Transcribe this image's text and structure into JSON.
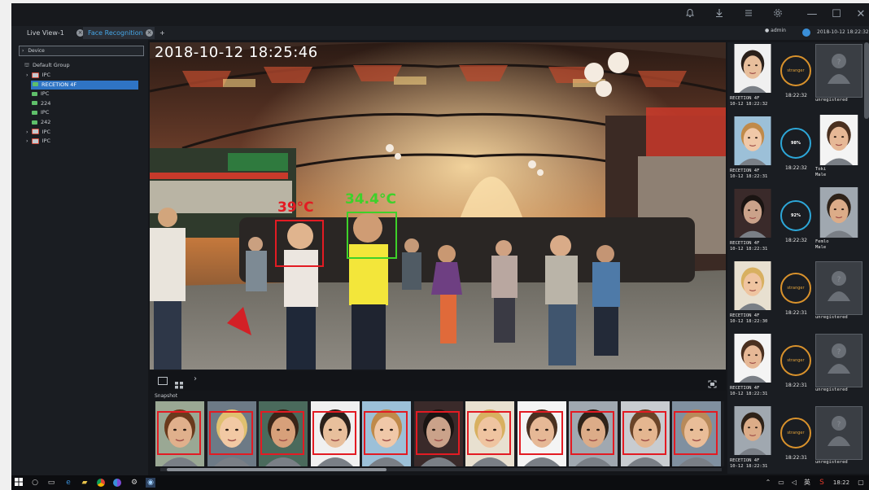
{
  "tabs": [
    {
      "label": "Live View-1",
      "active": false
    },
    {
      "label": "Face Recognition",
      "active": true
    }
  ],
  "add_tab_label": "+",
  "user": {
    "name": "admin",
    "datetime": "2018-10-12 18:22:32"
  },
  "window_controls": {
    "minimize": "—",
    "maximize": "☐",
    "close": "✕"
  },
  "toolbar_icons": [
    "bell-icon",
    "download-icon",
    "menu-icon",
    "settings-icon"
  ],
  "sidebar": {
    "header": "Device",
    "group": "Default Group",
    "items": [
      {
        "label": "IPC",
        "expandable": true,
        "selected": false,
        "kind": "nvr"
      },
      {
        "label": "RECETION 4F",
        "expandable": false,
        "selected": true,
        "kind": "cam"
      },
      {
        "label": "IPC",
        "expandable": false,
        "selected": false,
        "kind": "cam"
      },
      {
        "label": "224",
        "expandable": false,
        "selected": false,
        "kind": "cam"
      },
      {
        "label": "IPC",
        "expandable": false,
        "selected": false,
        "kind": "cam"
      },
      {
        "label": "242",
        "expandable": false,
        "selected": false,
        "kind": "cam"
      },
      {
        "label": "IPC",
        "expandable": true,
        "selected": false,
        "kind": "nvr"
      },
      {
        "label": "IPC",
        "expandable": true,
        "selected": false,
        "kind": "nvr"
      }
    ]
  },
  "video": {
    "timestamp": "2018-10-12  18:25:46",
    "detections": [
      {
        "temperature": "39°C",
        "color": "#e31b23"
      },
      {
        "temperature": "34.4°C",
        "color": "#3ed12a"
      }
    ]
  },
  "snapshot": {
    "label": "Snapshot",
    "face_count": 11
  },
  "recognition": [
    {
      "caption": "RECETION 4F\n10-12 18:22:32",
      "match": "stranger",
      "time": "18:22:32",
      "right_caption": "unregistered",
      "registered": false
    },
    {
      "caption": "RECETION 4F\n10-12 18:22:31",
      "match": "98%",
      "time": "18:22:32",
      "right_caption": "Toki\nMale",
      "registered": true
    },
    {
      "caption": "RECETION 4F\n10-12 18:22:31",
      "match": "92%",
      "time": "18:22:32",
      "right_caption": "Femlo\nMale",
      "registered": true
    },
    {
      "caption": "RECETION 4F\n10-12 18:22:30",
      "match": "stranger",
      "time": "18:22:31",
      "right_caption": "unregistered",
      "registered": false
    },
    {
      "caption": "RECETION 4F\n10-12 18:22:31",
      "match": "stranger",
      "time": "18:22:31",
      "right_caption": "unregistered",
      "registered": false
    },
    {
      "caption": "RECETION 4F\n10-12 18:22:31",
      "match": "stranger",
      "time": "18:22:31",
      "right_caption": "unregistered",
      "registered": false
    }
  ],
  "taskbar": {
    "ime": "英",
    "clock": "18:22"
  }
}
